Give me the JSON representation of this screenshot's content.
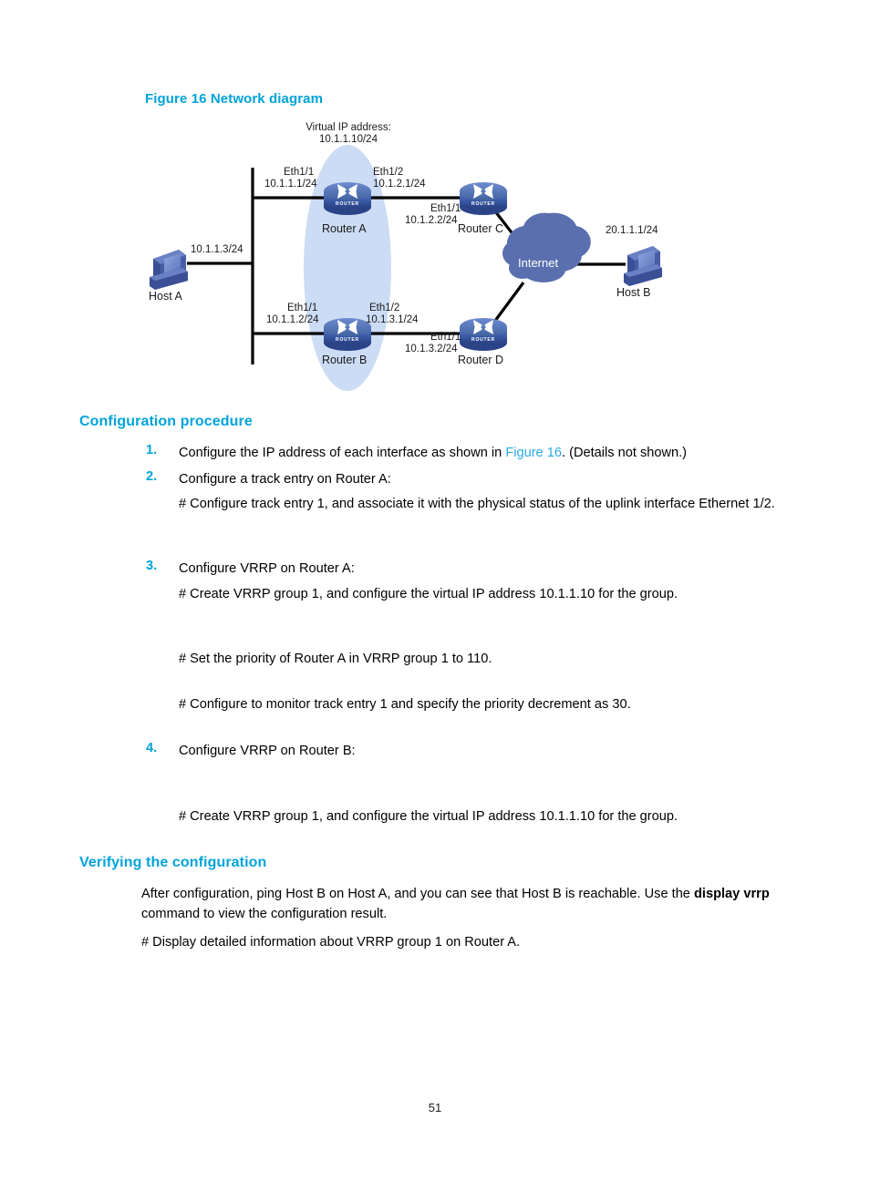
{
  "figure": {
    "caption": "Figure 16 Network diagram",
    "virtual_ip_line1": "Virtual IP address:",
    "virtual_ip_line2": "10.1.1.10/24",
    "cloud_label": "Internet",
    "nodes": {
      "router_a": "Router A",
      "router_b": "Router B",
      "router_c": "Router C",
      "router_d": "Router D",
      "host_a": "Host A",
      "host_b": "Host B"
    },
    "interfaces": {
      "router_a_eth1_1_name": "Eth1/1",
      "router_a_eth1_1_ip": "10.1.1.1/24",
      "router_a_eth1_2_name": "Eth1/2",
      "router_a_eth1_2_ip": "10.1.2.1/24",
      "router_b_eth1_1_name": "Eth1/1",
      "router_b_eth1_1_ip": "10.1.1.2/24",
      "router_b_eth1_2_name": "Eth1/2",
      "router_b_eth1_2_ip": "10.1.3.1/24",
      "router_c_eth1_1_name": "Eth1/1",
      "router_c_eth1_1_ip": "10.1.2.2/24",
      "router_d_eth1_1_name": "Eth1/1",
      "router_d_eth1_1_ip": "10.1.3.2/24",
      "host_a_ip": "10.1.1.3/24",
      "host_b_ip": "20.1.1.1/24"
    },
    "router_badge": "ROUTER",
    "colors": {
      "heading_blue": "#00a3da",
      "link_blue": "#29abe2",
      "device_blue": "#3b5ca8",
      "cloud_blue": "#5a6fae",
      "highlight_ellipse": "#c5d7f2"
    }
  },
  "sections": {
    "configuration_procedure": {
      "heading": "Configuration procedure",
      "steps": [
        {
          "number": "1.",
          "text_before_link": "Configure the IP address of each interface as shown in ",
          "link": "Figure 16",
          "text_after_link": ". (Details not shown.)"
        },
        {
          "number": "2.",
          "text": "Configure a track entry on Router A:"
        },
        {
          "number": "3.",
          "text": "Configure VRRP on Router A:"
        },
        {
          "number": "4.",
          "text": "Configure VRRP on Router B:"
        }
      ],
      "notes": {
        "track_entry_line1": "# Configure track entry 1, and associate it with the physical status of the uplink interface Ethernet",
        "track_entry_line2": "1/2.",
        "create_group_a": "# Create VRRP group 1, and configure the virtual IP address 10.1.1.10 for the group.",
        "set_priority": "# Set the priority of Router A in VRRP group 1 to 110.",
        "monitor_track": "# Configure to monitor track entry 1 and specify the priority decrement as 30.",
        "create_group_b": "# Create VRRP group 1, and configure the virtual IP address 10.1.1.10 for the group."
      }
    },
    "verifying": {
      "heading": "Verifying the configuration",
      "paragraph_part1": "After configuration, ping Host B on Host A, and you can see that Host B is reachable. Use the ",
      "paragraph_bold1": "display",
      "paragraph_bold2": "vrrp",
      "paragraph_part2": " command to view the configuration result.",
      "display_note": "# Display detailed information about VRRP group 1 on Router A."
    }
  },
  "footer": {
    "page_number": "51"
  }
}
